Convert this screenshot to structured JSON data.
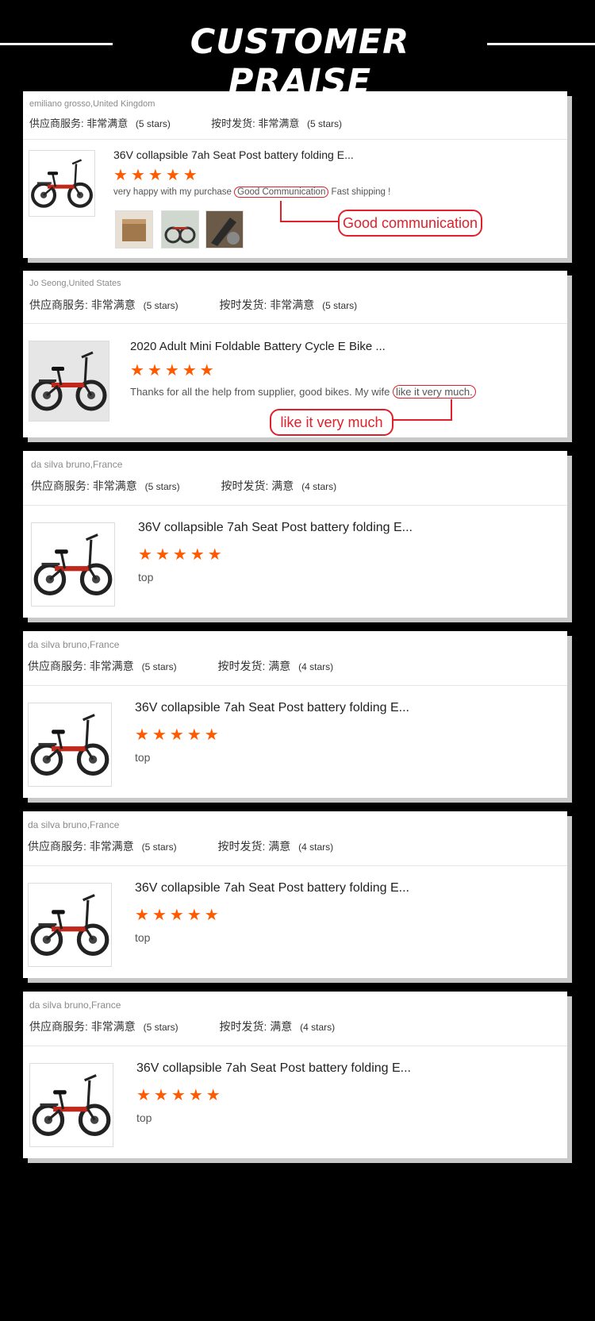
{
  "header": {
    "title": "CUSTOMER PRAISE"
  },
  "colors": {
    "accent": "#e0202a",
    "star": "#ff5a00"
  },
  "reviews": [
    {
      "user": "emiliano grosso,United Kingdom",
      "supplier_label": "供应商服务:",
      "supplier_value": "非常满意",
      "supplier_stars": "(5 stars)",
      "shipping_label": "按时发货:",
      "shipping_value": "非常满意",
      "shipping_stars": "(5 stars)",
      "product_title": "36V collapsible 7ah Seat Post battery folding E...",
      "rating": 5,
      "review_pre": "very happy with my purchase ",
      "review_hl": "Good Communication",
      "review_post": " Fast shipping !",
      "callout": "Good communication",
      "photos": [
        "photo-box",
        "photo-bike",
        "photo-frame"
      ]
    },
    {
      "user": "Jo Seong,United States",
      "supplier_label": "供应商服务:",
      "supplier_value": "非常满意",
      "supplier_stars": "(5 stars)",
      "shipping_label": "按时发货:",
      "shipping_value": "非常满意",
      "shipping_stars": "(5 stars)",
      "product_title": "2020 Adult Mini Foldable Battery Cycle E Bike ...",
      "rating": 5,
      "review_pre": "Thanks for all the help from supplier, good bikes. My wife ",
      "review_hl": "like it very much.",
      "review_post": "",
      "callout": "like it very much"
    },
    {
      "user": "da silva bruno,France",
      "supplier_label": "供应商服务:",
      "supplier_value": "非常满意",
      "supplier_stars": "(5 stars)",
      "shipping_label": "按时发货:",
      "shipping_value": "满意",
      "shipping_stars": "(4 stars)",
      "product_title": "36V collapsible 7ah Seat Post battery folding E...",
      "rating": 5,
      "review": "top"
    },
    {
      "user": "da silva bruno,France",
      "supplier_label": "供应商服务:",
      "supplier_value": "非常满意",
      "supplier_stars": "(5 stars)",
      "shipping_label": "按时发货:",
      "shipping_value": "满意",
      "shipping_stars": "(4 stars)",
      "product_title": "36V collapsible 7ah Seat Post battery folding E...",
      "rating": 5,
      "review": "top"
    },
    {
      "user": "da silva bruno,France",
      "supplier_label": "供应商服务:",
      "supplier_value": "非常满意",
      "supplier_stars": "(5 stars)",
      "shipping_label": "按时发货:",
      "shipping_value": "满意",
      "shipping_stars": "(4 stars)",
      "product_title": "36V collapsible 7ah Seat Post battery folding E...",
      "rating": 5,
      "review": "top"
    },
    {
      "user": "da silva bruno,France",
      "supplier_label": "供应商服务:",
      "supplier_value": "非常满意",
      "supplier_stars": "(5 stars)",
      "shipping_label": "按时发货:",
      "shipping_value": "满意",
      "shipping_stars": "(4 stars)",
      "product_title": "36V collapsible 7ah Seat Post battery folding E...",
      "rating": 5,
      "review": "top"
    }
  ]
}
